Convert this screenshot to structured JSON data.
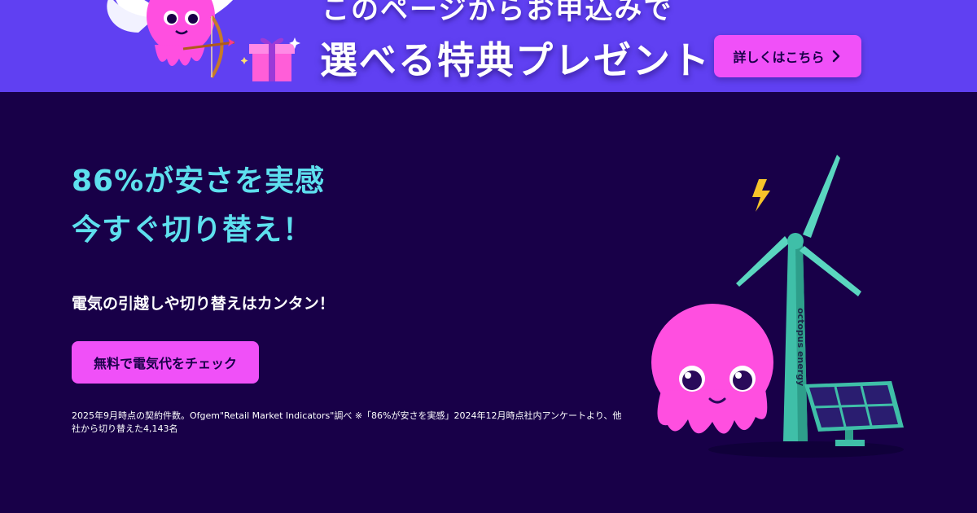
{
  "banner": {
    "line1": "このページからお申込みで",
    "line2": "選べる特典プレゼント",
    "cta_label": "詳しくはこちら"
  },
  "hero": {
    "headline_line1": "86%が安さを実感",
    "headline_line2": "今すぐ切り替え！",
    "subhead": "電気の引越しや切り替えはカンタン！",
    "cta_label": "無料で電気代をチェック",
    "footnote": "2025年9月時点の契約件数。Ofgem\"Retail Market Indicators\"調べ ※「86%が安さを実感」2024年12月時点社内アンケートより、他社から切り替えた4,143名"
  },
  "illustration": {
    "turbine_brand": "octopus energy"
  },
  "colors": {
    "background": "#180048",
    "banner": "#6040f2",
    "accent_pink": "#f050f8",
    "headline_cyan": "#5ee0ee",
    "turbine_teal": "#3fbfa8"
  },
  "icons": [
    "cupid-octopus-icon",
    "gift-box-icon",
    "chevron-right-icon",
    "lightning-icon",
    "wind-turbine-icon",
    "solar-panel-icon",
    "octopus-mascot-icon"
  ]
}
